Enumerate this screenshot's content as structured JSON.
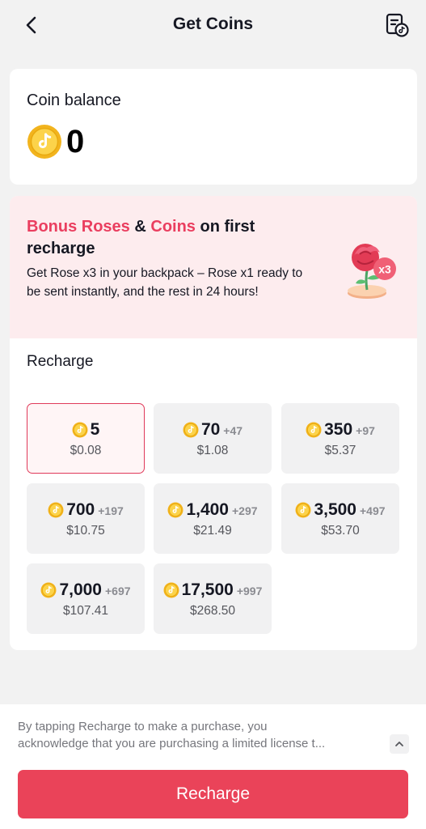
{
  "header": {
    "title": "Get Coins",
    "back_icon": "chevron-left-icon",
    "history_icon": "transaction-history-icon"
  },
  "balance": {
    "label": "Coin balance",
    "value": "0",
    "coin_icon": "tiktok-coin-icon"
  },
  "promo": {
    "title_part1": "Bonus Roses",
    "title_part2": " & ",
    "title_part3": "Coins",
    "title_part4": " on first recharge",
    "description": "Get Rose x3 in your backpack – Rose x1 ready to be sent instantly, and the rest in 24 hours!",
    "badge": "x3",
    "accent_color": "#ea3e5f",
    "background_color": "#fdecee"
  },
  "recharge": {
    "label": "Recharge",
    "packages": [
      {
        "coins": "5",
        "bonus": "",
        "price": "$0.08",
        "selected": true
      },
      {
        "coins": "70",
        "bonus": "+47",
        "price": "$1.08",
        "selected": false
      },
      {
        "coins": "350",
        "bonus": "+97",
        "price": "$5.37",
        "selected": false
      },
      {
        "coins": "700",
        "bonus": "+197",
        "price": "$10.75",
        "selected": false
      },
      {
        "coins": "1,400",
        "bonus": "+297",
        "price": "$21.49",
        "selected": false
      },
      {
        "coins": "3,500",
        "bonus": "+497",
        "price": "$53.70",
        "selected": false
      },
      {
        "coins": "7,000",
        "bonus": "+697",
        "price": "$107.41",
        "selected": false
      },
      {
        "coins": "17,500",
        "bonus": "+997",
        "price": "$268.50",
        "selected": false
      }
    ]
  },
  "footer": {
    "disclaimer_line1": "By tapping Recharge to make a purchase, you",
    "disclaimer_line2": "acknowledge that you are purchasing a limited license t...",
    "expand_icon": "chevron-up-icon",
    "button_label": "Recharge",
    "button_color": "#ea4359"
  }
}
